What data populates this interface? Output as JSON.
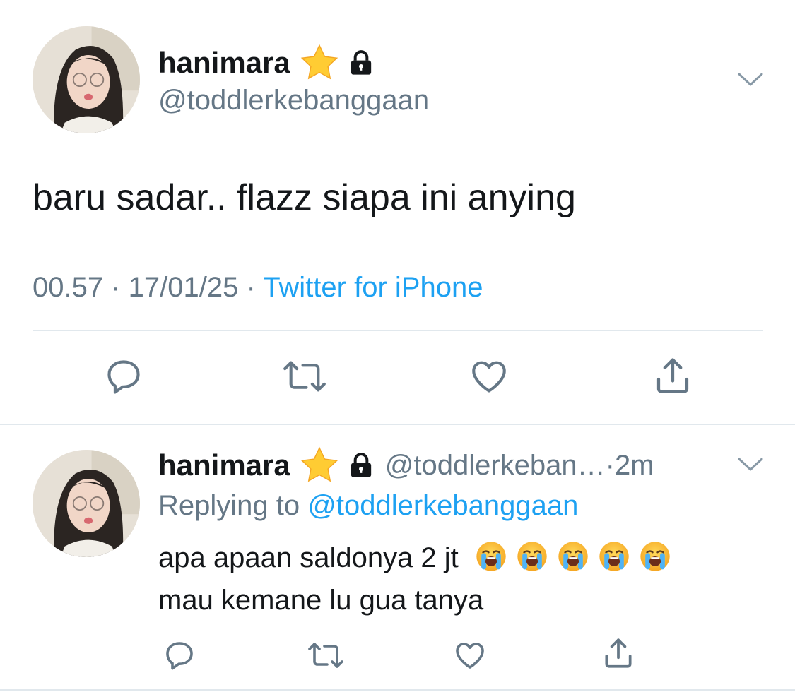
{
  "main_tweet": {
    "author_name": "hanimara",
    "handle": "@toddlerkebanggaan",
    "text": "baru sadar.. flazz siapa ini anying",
    "time": "00.57",
    "separator1": " · ",
    "date": "17/01/25",
    "separator2": " · ",
    "source": "Twitter for iPhone",
    "icons": [
      "star-icon",
      "lock-icon",
      "chevron-down-icon",
      "reply-icon",
      "retweet-icon",
      "like-icon",
      "share-icon"
    ]
  },
  "reply_tweet": {
    "author_name": "hanimara",
    "handle_truncated": "@toddlerkeban…",
    "time_ago": "2m",
    "dot": " · ",
    "replying_prefix": "Replying to ",
    "replying_handle": "@toddlerkebanggaan",
    "line1": "apa apaan saldonya 2 jt",
    "line2": "mau kemane lu gua tanya",
    "emoji_name": "loudly-crying-face-emoji",
    "emoji_count": 5
  },
  "colors": {
    "text": "#14171a",
    "muted": "#657786",
    "link": "#1da1f2",
    "divider": "#e1e8ed",
    "star": "#ffcc33",
    "icon": "#657786"
  }
}
